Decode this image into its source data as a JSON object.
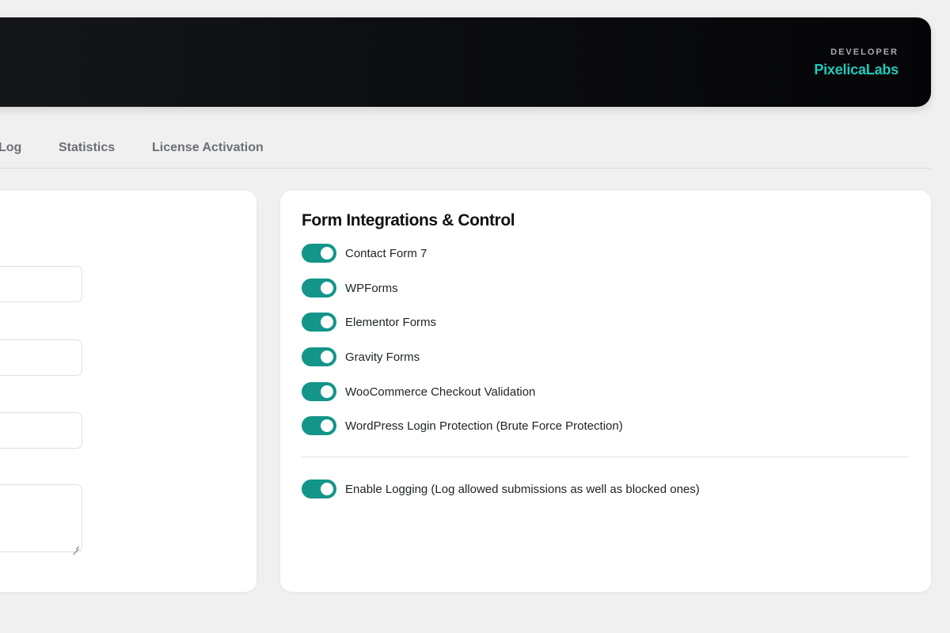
{
  "header": {
    "developer_label": "DEVELOPER",
    "developer_name": "PixelicaLabs",
    "accent_color": "#22c9bc"
  },
  "tabs": [
    {
      "label": "Log"
    },
    {
      "label": "Statistics"
    },
    {
      "label": "License Activation"
    }
  ],
  "integrations": {
    "title": "Form Integrations & Control",
    "toggle_color": "#13958a",
    "items": [
      {
        "label": "Contact Form 7",
        "enabled": true
      },
      {
        "label": "WPForms",
        "enabled": true
      },
      {
        "label": "Elementor Forms",
        "enabled": true
      },
      {
        "label": "Gravity Forms",
        "enabled": true
      },
      {
        "label": "WooCommerce Checkout Validation",
        "enabled": true
      },
      {
        "label": "WordPress Login Protection (Brute Force Protection)",
        "enabled": true
      }
    ],
    "logging": {
      "label": "Enable Logging (Log allowed submissions as well as blocked ones)",
      "enabled": true
    }
  }
}
